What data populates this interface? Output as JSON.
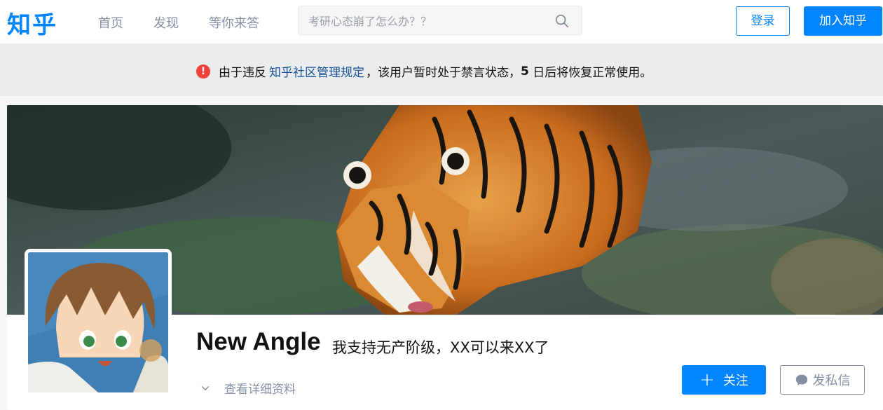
{
  "header": {
    "logo": "知乎",
    "nav": [
      "首页",
      "发现",
      "等你来答"
    ],
    "search_placeholder": "考研心态崩了怎么办？？",
    "login_label": "登录",
    "join_label": "加入知乎"
  },
  "notice": {
    "prefix": "由于违反",
    "link": "知乎社区管理规定",
    "suffix": "，该用户暂时处于禁言状态，",
    "days": "5",
    "tail": " 日后将恢复正常使用。"
  },
  "profile": {
    "name": "New Angle",
    "headline": "我支持无产阶级，XX可以来XX了",
    "detail_label": "查看详细资料",
    "follow_label": "关注",
    "message_label": "发私信"
  },
  "colors": {
    "brand": "#0084ff",
    "warning": "#f1403c",
    "link": "#175199"
  },
  "icons": [
    "search-icon",
    "warning-icon",
    "chevron-down-icon",
    "plus-icon",
    "chat-bubble-icon"
  ]
}
